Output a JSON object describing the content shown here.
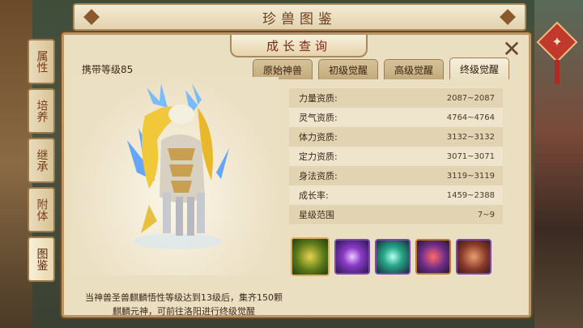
{
  "header": {
    "title": "珍兽图鉴"
  },
  "side_tabs": [
    {
      "label": "属性"
    },
    {
      "label": "培养"
    },
    {
      "label": "继承"
    },
    {
      "label": "附体"
    },
    {
      "label": "图鉴"
    }
  ],
  "panel": {
    "title": "成长查询",
    "carry_level": "携带等级85",
    "tabs": [
      {
        "label": "原始神兽"
      },
      {
        "label": "初级觉醒"
      },
      {
        "label": "高级觉醒"
      },
      {
        "label": "终级觉醒"
      }
    ],
    "active_tab": "终级觉醒",
    "description": "当神兽圣兽麒麟悟性等级达到13级后，集齐150颗麒麟元神，可前往洛阳进行终级觉醒",
    "stats": [
      {
        "label": "力量资质:",
        "value": "2087~2087"
      },
      {
        "label": "灵气资质:",
        "value": "4764~4764"
      },
      {
        "label": "体力资质:",
        "value": "3132~3132"
      },
      {
        "label": "定力资质:",
        "value": "3071~3071"
      },
      {
        "label": "身法资质:",
        "value": "3119~3119"
      },
      {
        "label": "成长率:",
        "value": "1459~2388"
      },
      {
        "label": "星级范围",
        "value": "7~9"
      }
    ],
    "skills": [
      {
        "icon": "book-skill-icon"
      },
      {
        "icon": "purple-orb-skill-icon"
      },
      {
        "icon": "teal-burst-skill-icon"
      },
      {
        "icon": "demon-face-skill-icon"
      },
      {
        "icon": "fist-skill-icon"
      }
    ]
  }
}
